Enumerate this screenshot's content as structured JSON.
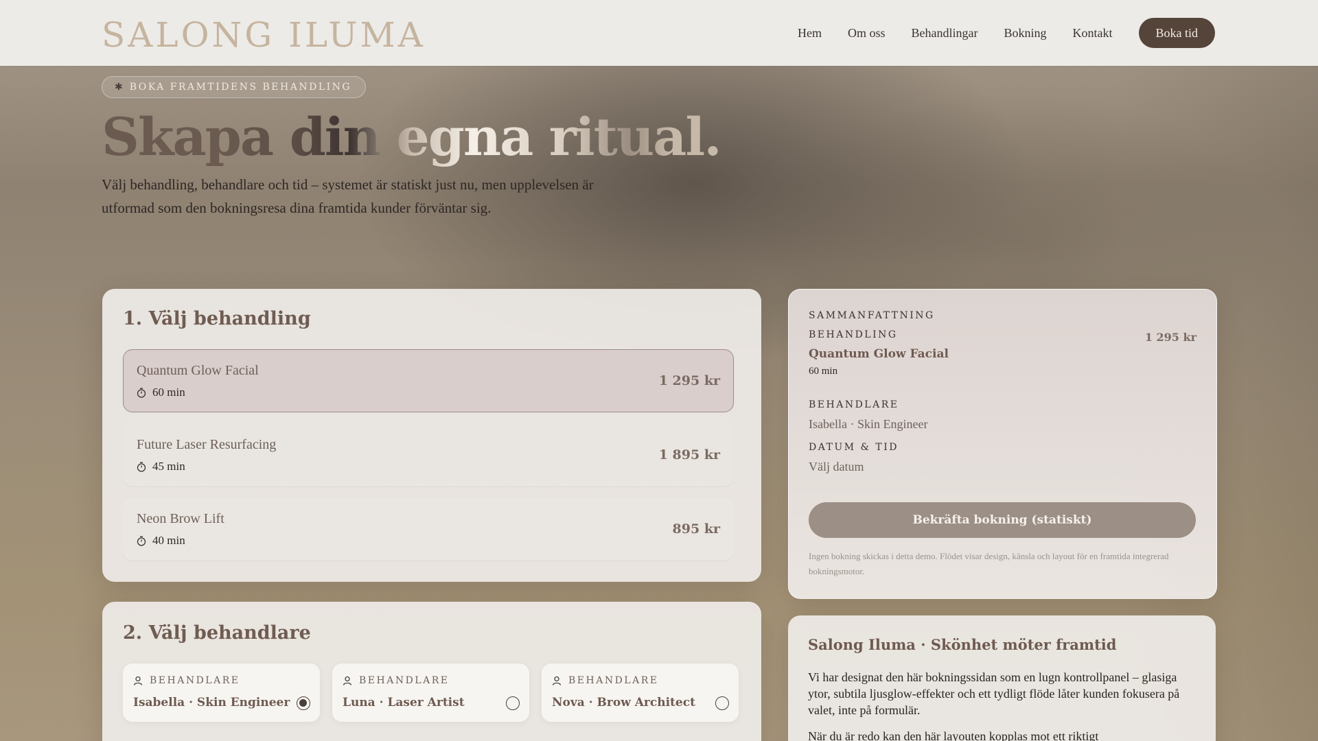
{
  "header": {
    "logo": "SALONG ILUMA",
    "nav": [
      "Hem",
      "Om oss",
      "Behandlingar",
      "Bokning",
      "Kontakt"
    ],
    "cta": "Boka tid"
  },
  "hero": {
    "eyebrow": "BOKA FRAMTIDENS BEHANDLING",
    "title": "Skapa din egna ritual.",
    "text": "Välj behandling, behandlare och tid – systemet är statiskt just nu, men upplevelsen är utformad som den bokningsresa dina framtida kunder förväntar sig."
  },
  "treatments": {
    "title": "1. Välj behandling",
    "items": [
      {
        "name": "Quantum Glow Facial",
        "duration": "60 min",
        "price": "1 295 kr",
        "selected": true
      },
      {
        "name": "Future Laser Resurfacing",
        "duration": "45 min",
        "price": "1 895 kr",
        "selected": false
      },
      {
        "name": "Neon Brow Lift",
        "duration": "40 min",
        "price": "895 kr",
        "selected": false
      }
    ]
  },
  "staff": {
    "title": "2. Välj behandlare",
    "options": [
      {
        "label": "BEHANDLARE",
        "name": "Isabella · Skin Engineer",
        "selected": true
      },
      {
        "label": "BEHANDLARE",
        "name": "Luna · Laser Artist",
        "selected": false
      },
      {
        "label": "BEHANDLARE",
        "name": "Nova · Brow Architect",
        "selected": false
      }
    ]
  },
  "summary": {
    "kicker": "SAMMANFATTNING",
    "treatment_label": "BEHANDLING",
    "treatment_name": "Quantum Glow Facial",
    "treatment_duration": "60 min",
    "price": "1 295 kr",
    "staff_label": "BEHANDLARE",
    "staff_value": "Isabella · Skin Engineer",
    "datetime_label": "DATUM & TID",
    "datetime_value": "Välj datum",
    "confirm": "Bekräfta bokning (statiskt)",
    "note": "Ingen bokning skickas i detta demo. Flödet visar design, känsla och layout för en framtida integrerad bokningsmotor."
  },
  "about": {
    "title": "Salong Iluma · Skönhet möter framtid",
    "p1": "Vi har designat den här bokningssidan som en lugn kontrollpanel – glasiga ytor, subtila ljusglow-effekter och ett tydligt flöde låter kunden fokusera på valet, inte på formulär.",
    "p2": "När du är redo kan den här layouten kopplas mot ett riktigt"
  },
  "colors": {
    "accent": "#55443a",
    "selected_bg": "#d9cecc",
    "logo": "#c5b49f"
  }
}
